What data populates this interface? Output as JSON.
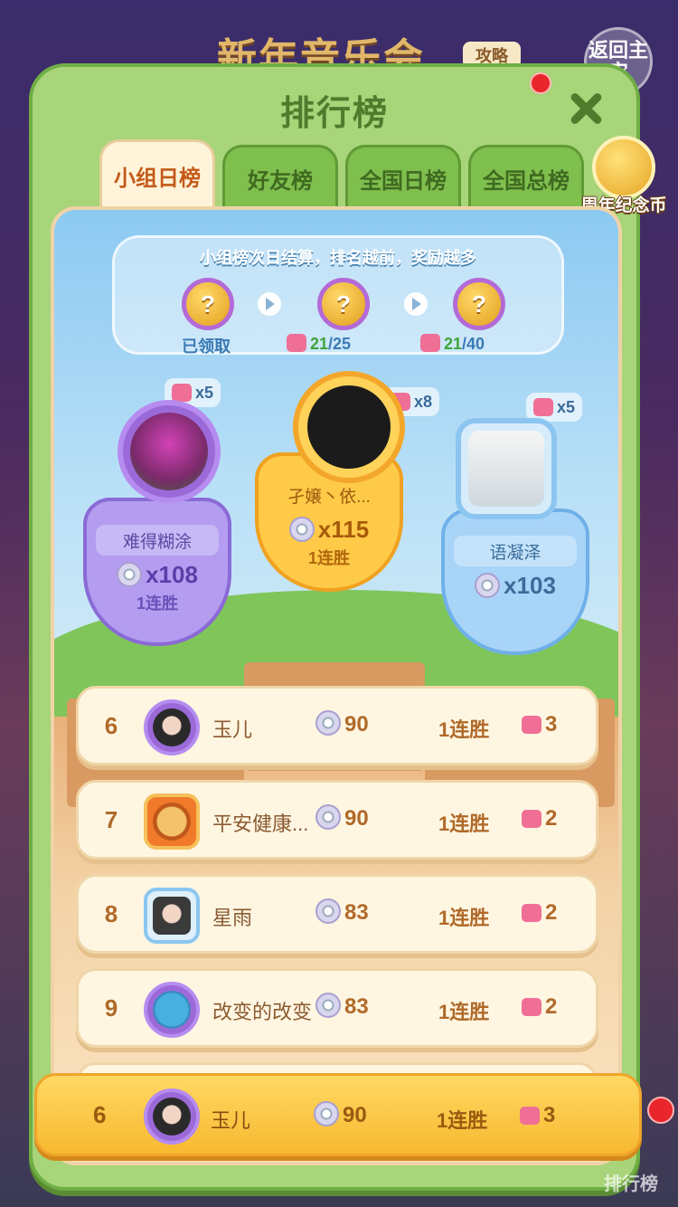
{
  "background": {
    "title": "新年音乐会",
    "strategy_label": "攻略",
    "back_label": "返回主宙"
  },
  "modal": {
    "title": "排行榜",
    "close_icon": "close-icon"
  },
  "tabs": [
    {
      "label": "小组日榜",
      "active": true
    },
    {
      "label": "好友榜",
      "active": false
    },
    {
      "label": "全国日榜",
      "active": false
    },
    {
      "label": "全国总榜",
      "active": false
    }
  ],
  "anniversary": {
    "label": "周年纪念币"
  },
  "rewards": {
    "title": "小组榜次日结算，排名越前，奖励越多",
    "items": [
      {
        "status": "已领取"
      },
      {
        "current": "21",
        "target": "/25"
      },
      {
        "current": "21",
        "target": "/40"
      }
    ]
  },
  "podium": [
    {
      "place": 2,
      "name": "难得糊涂",
      "score": "x108",
      "streak": "1连胜",
      "bonus": "x5"
    },
    {
      "place": 1,
      "name": "孑嬢丶依...",
      "score": "x115",
      "streak": "1连胜",
      "bonus": "x8"
    },
    {
      "place": 3,
      "name": "语凝泽",
      "score": "x103",
      "bonus": "x5"
    }
  ],
  "list": [
    {
      "rank": "6",
      "name": "玉儿",
      "score": "90",
      "streak": "1连胜",
      "pieces": "3"
    },
    {
      "rank": "7",
      "name": "平安健康...",
      "score": "90",
      "streak": "1连胜",
      "pieces": "2"
    },
    {
      "rank": "8",
      "name": "星雨",
      "score": "83",
      "streak": "1连胜",
      "pieces": "2"
    },
    {
      "rank": "9",
      "name": "改变的改变",
      "score": "83",
      "streak": "1连胜",
      "pieces": "2"
    }
  ],
  "self": {
    "rank": "6",
    "name": "玉儿",
    "score": "90",
    "streak": "1连胜",
    "pieces": "3"
  },
  "side_label": "排行榜",
  "colors": {
    "modal_green": "#a8d47a",
    "active_tab": "#fff4d9",
    "gold": "#ffca47",
    "purple": "#b49df0",
    "blue": "#a8d4f8"
  }
}
